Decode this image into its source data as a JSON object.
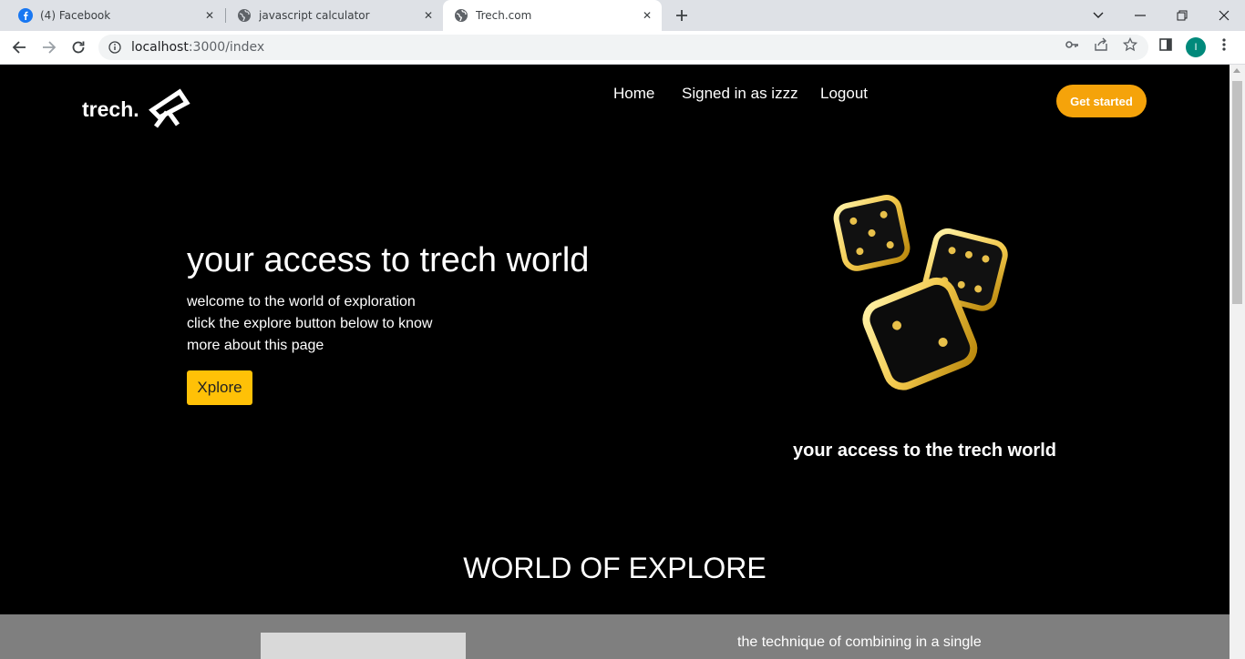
{
  "browser": {
    "tabs": [
      {
        "title": "(4) Facebook",
        "icon": "facebook-icon",
        "active": false
      },
      {
        "title": "javascript calculator",
        "icon": "globe-icon",
        "active": false
      },
      {
        "title": "Trech.com",
        "icon": "globe-icon",
        "active": true
      }
    ],
    "url_host": "localhost",
    "url_path": ":3000/index",
    "profile_initial": "I"
  },
  "page": {
    "brand": "trech.",
    "nav": {
      "home": "Home",
      "signed_in": "Signed in as izzz",
      "logout": "Logout"
    },
    "cta": "Get started",
    "hero": {
      "title": "your access to trech world",
      "lines": [
        "welcome to the world of exploration",
        "click the explore button below to know",
        "more about this page"
      ],
      "button": "Xplore"
    },
    "image_caption": "your access to the trech world",
    "section_title": "WORLD OF EXPLORE",
    "band_text": "the technique of combining in a single"
  },
  "colors": {
    "accent_orange": "#f5a30a",
    "accent_yellow": "#ffc107",
    "page_bg": "#000000",
    "band_bg": "#7f7f7f"
  }
}
